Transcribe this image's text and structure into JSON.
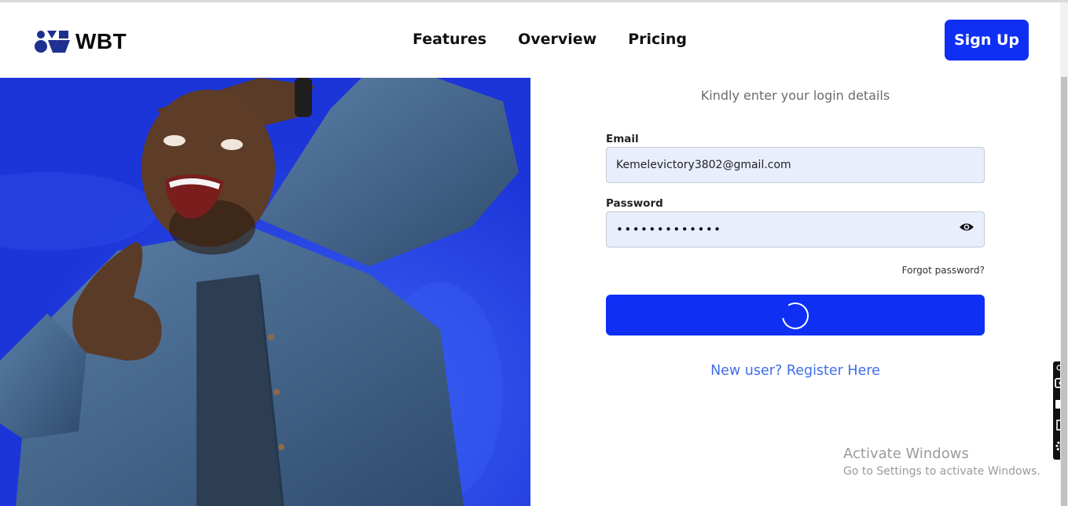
{
  "header": {
    "logo_text": "WBT",
    "nav": [
      "Features",
      "Overview",
      "Pricing"
    ],
    "signup_label": "Sign Up"
  },
  "form": {
    "subtitle": "Kindly enter your login details",
    "email_label": "Email",
    "email_value": "Kemelevictory3802@gmail.com",
    "password_label": "Password",
    "password_mask": "•••••••••••••",
    "forgot_label": "Forgot password?",
    "register_label": "New user? Register Here"
  },
  "watermark": {
    "title": "Activate Windows",
    "subtitle": "Go to Settings to activate Windows."
  },
  "colors": {
    "brand_blue": "#0f2ff5",
    "hero_blue": "#1f3fe0",
    "link_blue": "#3f6ee8"
  }
}
